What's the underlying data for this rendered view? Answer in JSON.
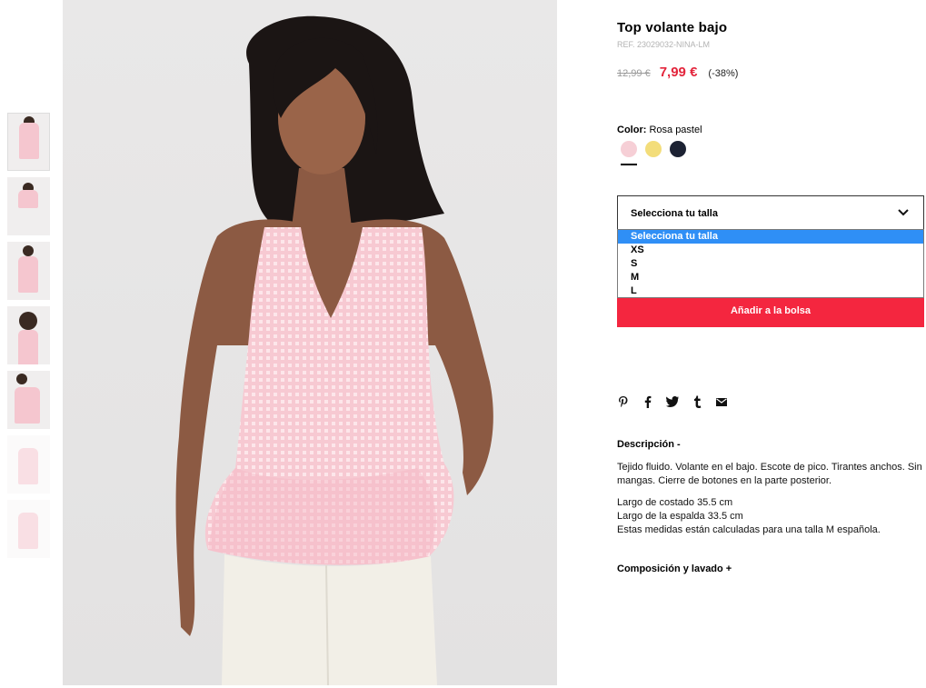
{
  "product": {
    "title": "Top volante bajo",
    "ref": "REF. 23029032-NINA-LM",
    "old_price": "12,99 €",
    "new_price": "7,99 €",
    "discount": "(-38%)"
  },
  "color": {
    "label": "Color:",
    "selected": "Rosa pastel",
    "swatches": [
      {
        "name": "rosa-pastel",
        "hex": "#f6cfd6"
      },
      {
        "name": "amarillo",
        "hex": "#f3dd7a"
      },
      {
        "name": "azul-marino",
        "hex": "#1c2233"
      }
    ]
  },
  "size": {
    "placeholder": "Selecciona tu talla",
    "options": [
      "Selecciona tu talla",
      "XS",
      "S",
      "M",
      "L"
    ],
    "selected_index": 0
  },
  "add_to_bag": "Añadir a la bolsa",
  "share_icons": [
    "pinterest-icon",
    "facebook-icon",
    "twitter-icon",
    "tumblr-icon",
    "email-icon"
  ],
  "description": {
    "title": "Descripción  -",
    "paragraph1": "Tejido fluido. Volante en el bajo. Escote de pico. Tirantes anchos. Sin mangas. Cierre de botones en la parte posterior.",
    "measure1": "Largo de costado 35.5 cm",
    "measure2": "Largo de la espalda 33.5 cm",
    "measure3": "Estas medidas están calculadas para una talla M española."
  },
  "composition_title": "Composición y lavado  +",
  "colors": {
    "accent_red": "#e3243b",
    "button_red": "#f4263f",
    "select_blue": "#2f8ff6"
  }
}
